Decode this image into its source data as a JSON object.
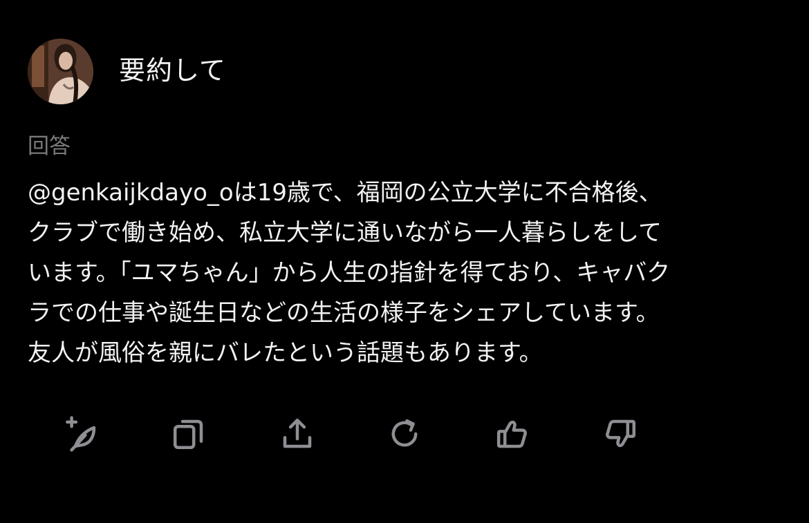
{
  "prompt": {
    "text": "要約して"
  },
  "answer": {
    "label": "回答",
    "lines": [
      "@genkaijkdayo_oは19歳で、福岡の公立大学に不合格後、",
      "クラブで働き始め、私立大学に通いながら一人暮らしをして",
      "います。「ユマちゃん」から人生の指針を得ており、キャバク",
      "ラでの仕事や誕生日などの生活の様子をシェアしています。",
      "友人が風俗を親にバレたという話題もあります。"
    ]
  },
  "actions": [
    {
      "icon": "add-note-icon"
    },
    {
      "icon": "copy-icon"
    },
    {
      "icon": "share-icon"
    },
    {
      "icon": "regenerate-icon"
    },
    {
      "icon": "thumbs-up-icon"
    },
    {
      "icon": "thumbs-down-icon"
    }
  ],
  "colors": {
    "background": "#000000",
    "text": "#f2f2f2",
    "muted": "#7a7a7a",
    "icon": "#8e8e93"
  }
}
